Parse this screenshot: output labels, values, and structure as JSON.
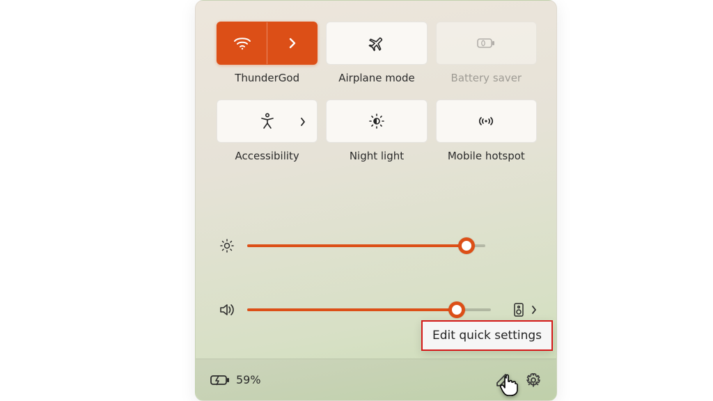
{
  "accent": "#dc4f17",
  "tiles": [
    {
      "id": "wifi",
      "label": "ThunderGod",
      "active": true,
      "disabled": false,
      "has_chevron": true
    },
    {
      "id": "airplane",
      "label": "Airplane mode",
      "active": false,
      "disabled": false,
      "has_chevron": false
    },
    {
      "id": "battery-saver",
      "label": "Battery saver",
      "active": false,
      "disabled": true,
      "has_chevron": false
    },
    {
      "id": "accessibility",
      "label": "Accessibility",
      "active": false,
      "disabled": false,
      "has_chevron": true
    },
    {
      "id": "night-light",
      "label": "Night light",
      "active": false,
      "disabled": false,
      "has_chevron": false
    },
    {
      "id": "hotspot",
      "label": "Mobile hotspot",
      "active": false,
      "disabled": false,
      "has_chevron": false
    }
  ],
  "sliders": {
    "brightness": {
      "percent": 92
    },
    "volume": {
      "percent": 86
    }
  },
  "footer": {
    "battery_percent_label": "59%"
  },
  "tooltip": {
    "text": "Edit quick settings"
  }
}
